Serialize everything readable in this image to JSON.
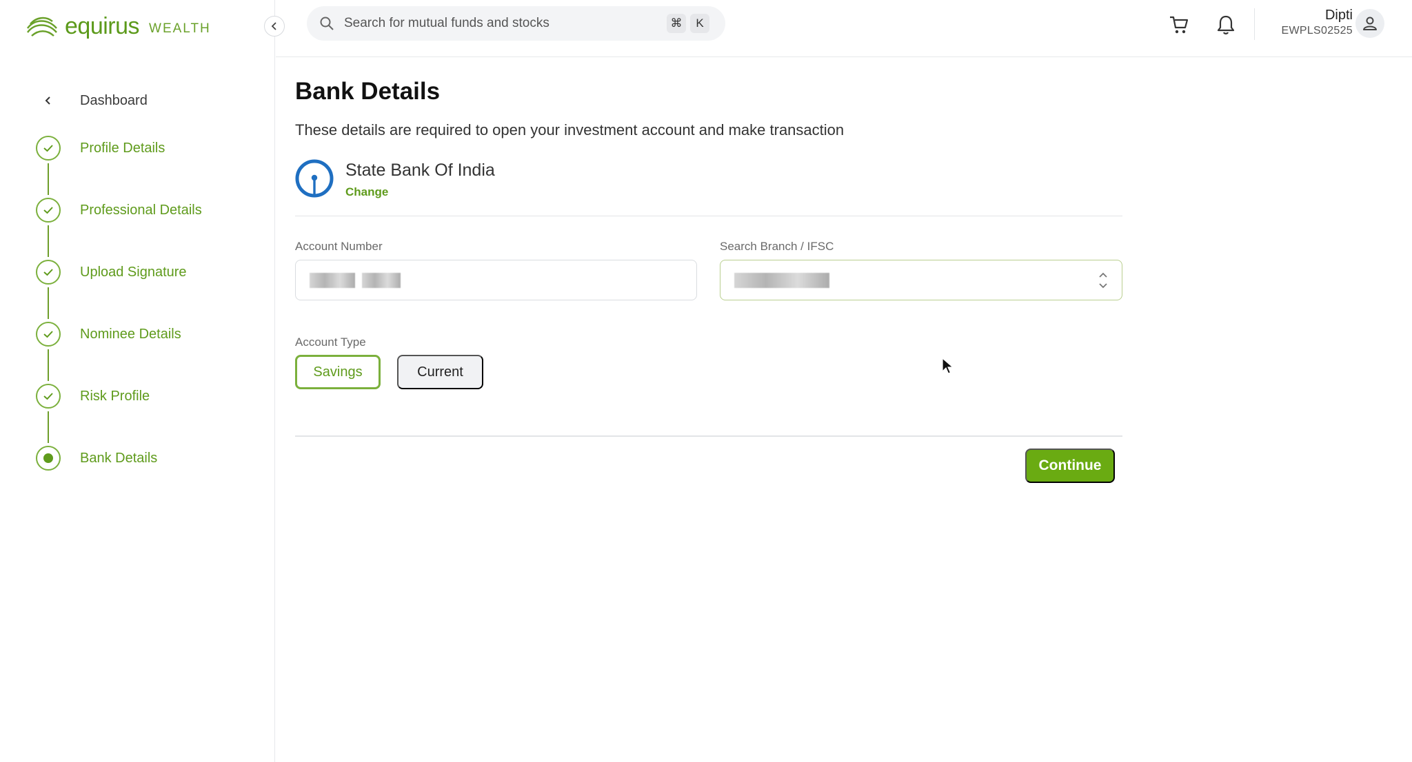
{
  "brand": {
    "name": "equirus",
    "sub": "WEALTH",
    "color": "#5f9b1c"
  },
  "sidebar": {
    "back_label": "Dashboard",
    "steps": [
      {
        "label": "Profile Details",
        "status": "completed"
      },
      {
        "label": "Professional Details",
        "status": "completed"
      },
      {
        "label": "Upload Signature",
        "status": "completed"
      },
      {
        "label": "Nominee Details",
        "status": "completed"
      },
      {
        "label": "Risk Profile",
        "status": "completed"
      },
      {
        "label": "Bank Details",
        "status": "current"
      }
    ]
  },
  "topbar": {
    "search_placeholder": "Search for mutual funds and stocks",
    "shortcut": {
      "modifier": "⌘",
      "key": "K"
    },
    "user": {
      "name": "Dipti",
      "id": "EWPLS02525"
    }
  },
  "main": {
    "title": "Bank Details",
    "subtitle": "These details are required to open your investment account and make transaction",
    "bank": {
      "name": "State Bank Of India",
      "change_label": "Change"
    },
    "account_number": {
      "label": "Account Number",
      "value_masked": true
    },
    "ifsc": {
      "label": "Search Branch / IFSC",
      "value_masked": true
    },
    "account_type": {
      "label": "Account Type",
      "options": [
        "Savings",
        "Current"
      ],
      "selected": "Savings"
    },
    "continue_label": "Continue"
  },
  "colors": {
    "accent": "#6aab12",
    "accent_text": "#5f9b1c",
    "sbi_blue": "#1f6fc1"
  }
}
